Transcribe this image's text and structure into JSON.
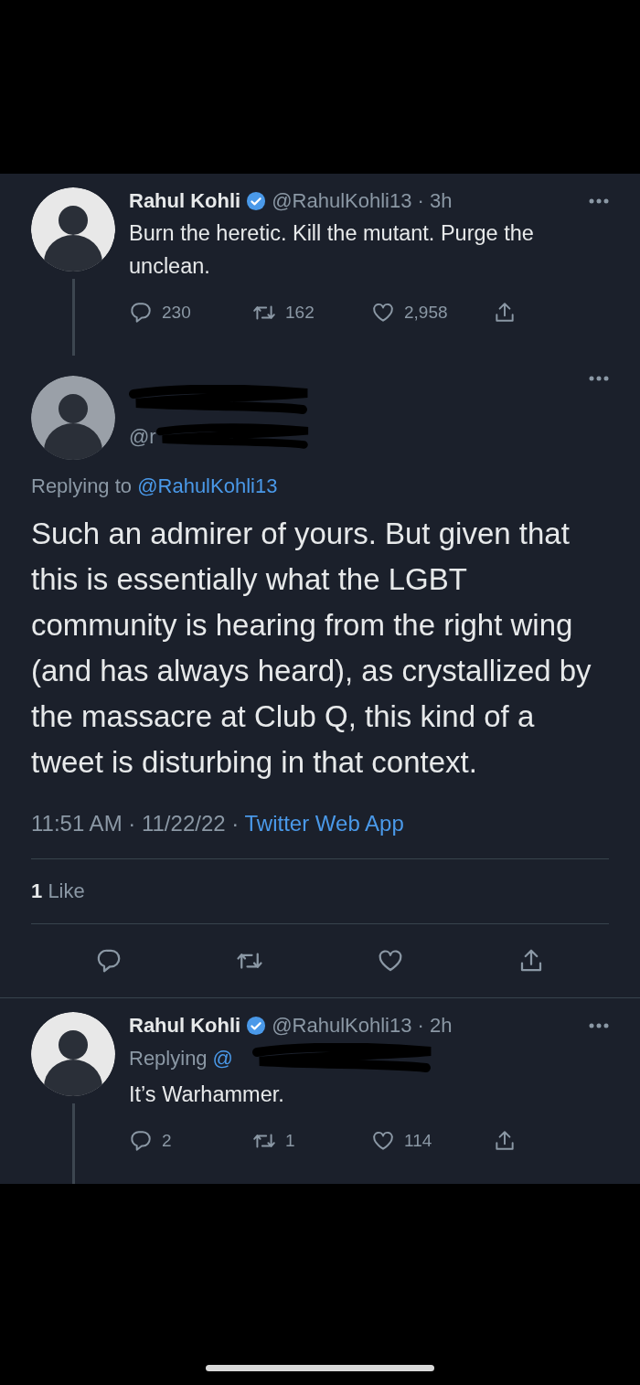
{
  "tweets": [
    {
      "kind": "compact",
      "author": "Rahul Kohli",
      "verified": true,
      "handle_time": "@RahulKohli13 · 3h",
      "thread_line": true,
      "text": "Burn the heretic. Kill the mutant. Purge the unclean.",
      "stats": {
        "replies": "230",
        "retweets": "162",
        "likes": "2,958"
      }
    },
    {
      "kind": "focused",
      "name_redacted": true,
      "handle": "@r",
      "handle_redacted": true,
      "replying_label": "Replying to",
      "replying_handle": "@RahulKohli13",
      "text": "Such an admirer of yours. But given that this is essentially what the LGBT community is hearing from the right wing (and has always heard), as crystallized by the massacre at Club Q, this kind of a tweet is disturbing in that context.",
      "timestamp": "11:51 AM · 11/22/22 · ",
      "source": "Twitter Web App",
      "likes_count": "1",
      "likes_label": "Like"
    },
    {
      "kind": "compact",
      "author": "Rahul Kohli",
      "verified": true,
      "handle_time": "@RahulKohli13 · 2h",
      "thread_line": true,
      "replying_label": "Replying",
      "replying_handle": "@",
      "replying_redacted": true,
      "text": "It’s Warhammer.",
      "stats": {
        "replies": "2",
        "retweets": "1",
        "likes": "114"
      }
    }
  ]
}
